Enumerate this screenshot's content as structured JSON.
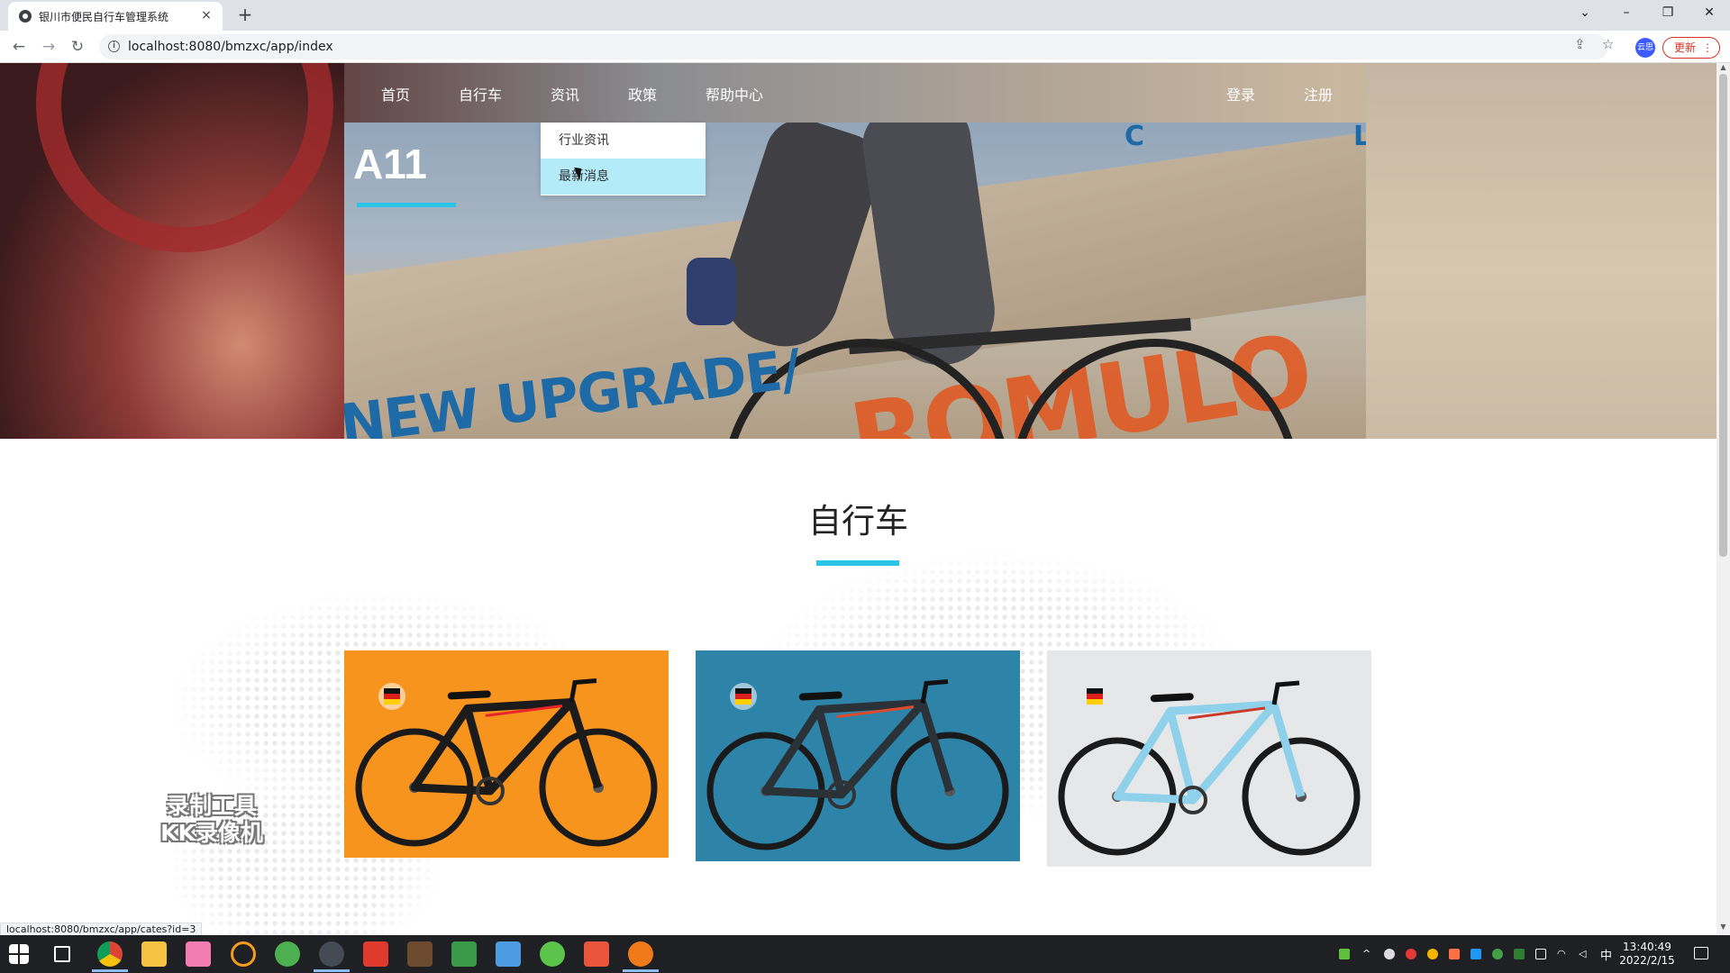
{
  "browser": {
    "tab_title": "银川市便民自行车管理系统",
    "tab_close": "×",
    "new_tab": "+",
    "url": "localhost:8080/bmzxc/app/index",
    "profile_label": "云思",
    "update_label": "更新",
    "status_url": "localhost:8080/bmzxc/app/cates?id=3",
    "icons": [
      "back-arrow-icon",
      "forward-arrow-icon",
      "reload-icon",
      "info-icon",
      "share-icon",
      "star-icon",
      "menu-dots-icon"
    ]
  },
  "nav": {
    "items": [
      "首页",
      "自行车",
      "资讯",
      "政策",
      "帮助中心"
    ],
    "login": "登录",
    "register": "注册",
    "dropdown": [
      "行业资讯",
      "最新消息"
    ],
    "dropdown_active_index": 1
  },
  "hero": {
    "slide_title": "A11",
    "slide_text": "NEW UPGRADE/",
    "accent_color": "#2bc4e6"
  },
  "section": {
    "title": "自行车"
  },
  "products": [
    {
      "bg_color": "#f7941e",
      "frame_color": "#1b1b1b",
      "accent": "#e8262a"
    },
    {
      "bg_color": "#2d83a8",
      "frame_color": "#2a3238",
      "accent": "#e04a2a"
    },
    {
      "bg_color": "#e6e7e9",
      "frame_color": "#8fd0ea",
      "accent": "#c93a2a"
    }
  ],
  "watermark": {
    "line1": "录制工具",
    "line2": "KK录像机"
  },
  "taskbar": {
    "time": "13:40:49",
    "date": "2022/2/15",
    "ime": "中"
  }
}
